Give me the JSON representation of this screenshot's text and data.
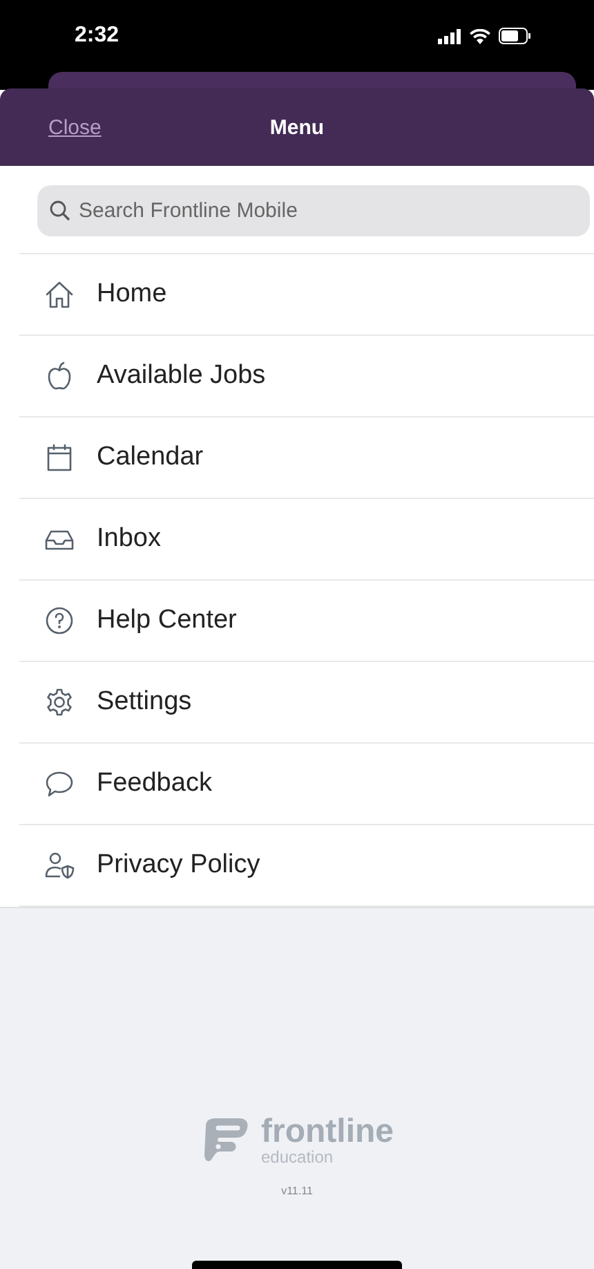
{
  "status_bar": {
    "time": "2:32"
  },
  "header": {
    "close": "Close",
    "title": "Menu"
  },
  "search": {
    "placeholder": "Search Frontline Mobile"
  },
  "menu_items": [
    {
      "kind": "home",
      "label": "Home"
    },
    {
      "kind": "jobs",
      "label": "Available Jobs"
    },
    {
      "kind": "calendar",
      "label": "Calendar"
    },
    {
      "kind": "inbox",
      "label": "Inbox"
    },
    {
      "kind": "help",
      "label": "Help Center"
    },
    {
      "kind": "settings",
      "label": "Settings"
    },
    {
      "kind": "feedback",
      "label": "Feedback"
    },
    {
      "kind": "privacy",
      "label": "Privacy Policy"
    }
  ],
  "footer": {
    "brand": "frontline",
    "sub": "education",
    "version": "v11.11"
  }
}
